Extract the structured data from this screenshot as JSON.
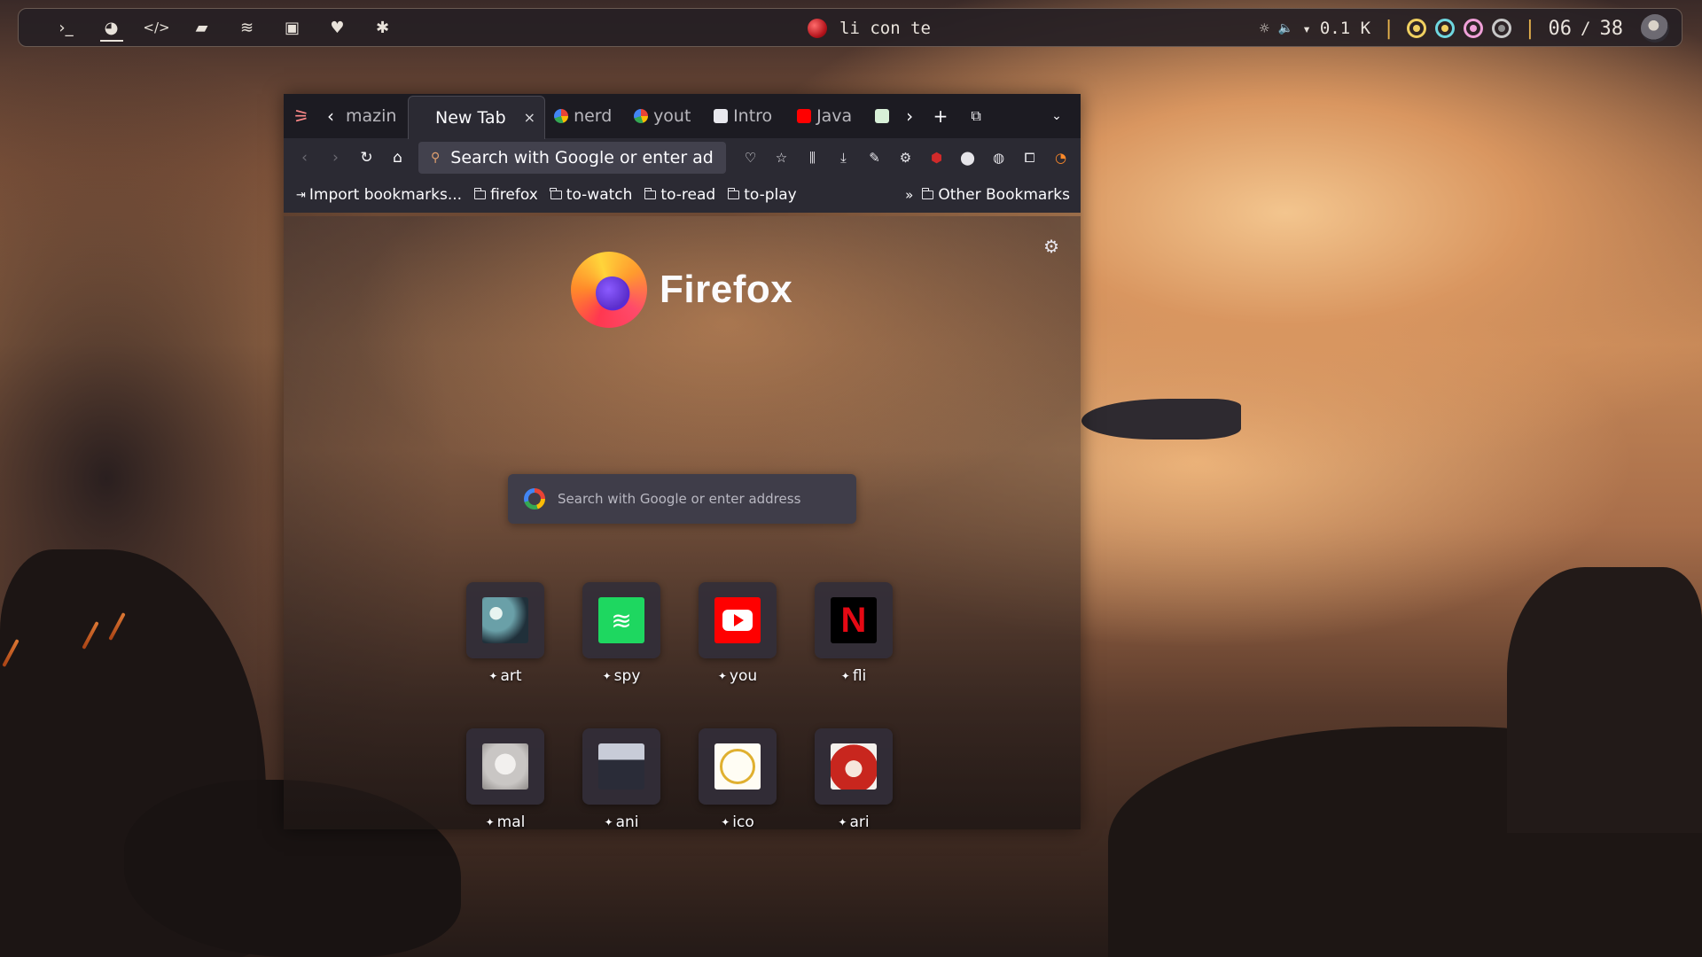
{
  "topbar": {
    "workspaces": [
      {
        "icon": "terminal-icon",
        "glyph": "›_"
      },
      {
        "icon": "firefox-icon",
        "glyph": "◕"
      },
      {
        "icon": "code-icon",
        "glyph": "</>"
      },
      {
        "icon": "folder-icon",
        "glyph": "▰"
      },
      {
        "icon": "spotify-icon",
        "glyph": "≋"
      },
      {
        "icon": "image-icon",
        "glyph": "▣"
      },
      {
        "icon": "heartbeat-icon",
        "glyph": "♥"
      },
      {
        "icon": "settings-icon",
        "glyph": "✱"
      }
    ],
    "now_playing": "li con te",
    "brightness_glyph": "☼",
    "volume_glyph": "🔈",
    "wifi_glyph": "▾",
    "net_speed": "0.1 K",
    "separator": "|",
    "time_hour": "06",
    "time_sep": "/",
    "time_min": "38",
    "ring_colors": [
      "#f0d060",
      "#6fd8e0",
      "#f0a0d8",
      "#c8c8c8"
    ]
  },
  "browser": {
    "tabs": [
      {
        "label": "mazin",
        "kind": "fade"
      },
      {
        "label": "New Tab",
        "kind": "active",
        "close": "×"
      },
      {
        "label": "nerd",
        "kind": "fade",
        "favicon": "google"
      },
      {
        "label": "yout",
        "kind": "fade",
        "favicon": "google"
      },
      {
        "label": "Intro",
        "kind": "fade",
        "favicon": "book"
      },
      {
        "label": "Java",
        "kind": "fade",
        "favicon": "youtube"
      }
    ],
    "urlbar_text": "Search with Google or enter ad",
    "bookmarks": {
      "import": "Import bookmarks...",
      "folders": [
        "firefox",
        "to-watch",
        "to-read",
        "to-play"
      ],
      "overflow": "»",
      "other": "Other Bookmarks"
    },
    "newtab": {
      "brand": "Firefox",
      "search_placeholder": "Search with Google or enter address",
      "shortcuts": [
        {
          "label": "art"
        },
        {
          "label": "spy"
        },
        {
          "label": "you"
        },
        {
          "label": "fli"
        },
        {
          "label": "mal"
        },
        {
          "label": "ani"
        },
        {
          "label": "ico"
        },
        {
          "label": "ari"
        }
      ]
    }
  },
  "colors": {
    "spotify": "#1ed760",
    "youtube": "#ff0000",
    "netflix": "#e50914",
    "accent_orange": "#ff8a2a"
  }
}
